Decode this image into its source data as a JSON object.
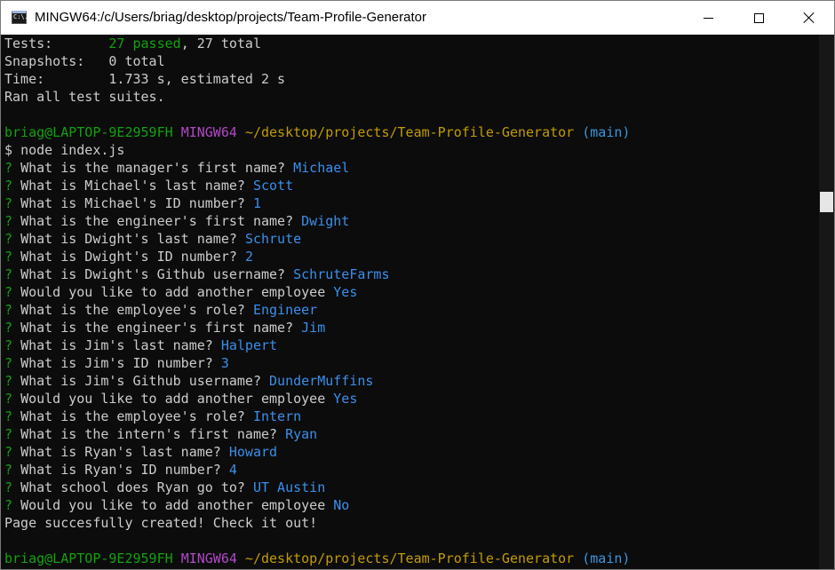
{
  "window": {
    "title": "MINGW64:/c/Users/briag/desktop/projects/Team-Profile-Generator",
    "icon_text": "C:\\."
  },
  "colors": {
    "background": "#0c0c0c",
    "text": "#cccccc",
    "green": "#13a10e",
    "purple": "#b148c6",
    "yellow": "#c19c00",
    "cyan": "#3a96dd",
    "answer_blue": "#3b8eea"
  },
  "terminal": {
    "summary": [
      {
        "label": "Tests:       ",
        "highlight": "27 passed",
        "rest": ", 27 total"
      },
      {
        "label": "Snapshots:   ",
        "highlight": "",
        "rest": "0 total"
      },
      {
        "label": "Time:        ",
        "highlight": "",
        "rest": "1.733 s, estimated 2 s"
      }
    ],
    "ran_all": "Ran all test suites.",
    "prompt": {
      "user_host": "briag@LAPTOP-9E2959FH",
      "shell": "MINGW64",
      "path": "~/desktop/projects/Team-Profile-Generator",
      "branch": "(main)",
      "dollar": "$"
    },
    "command": "node index.js",
    "questions": [
      {
        "q": "What is the manager's first name?",
        "a": "Michael"
      },
      {
        "q": "What is Michael's last name?",
        "a": "Scott"
      },
      {
        "q": "What is Michael's ID number?",
        "a": "1"
      },
      {
        "q": "What is the engineer's first name?",
        "a": "Dwight"
      },
      {
        "q": "What is Dwight's last name?",
        "a": "Schrute"
      },
      {
        "q": "What is Dwight's ID number?",
        "a": "2"
      },
      {
        "q": "What is Dwight's Github username?",
        "a": "SchruteFarms"
      },
      {
        "q": "Would you like to add another employee",
        "a": "Yes"
      },
      {
        "q": "What is the employee's role?",
        "a": "Engineer"
      },
      {
        "q": "What is the engineer's first name?",
        "a": "Jim"
      },
      {
        "q": "What is Jim's last name?",
        "a": "Halpert"
      },
      {
        "q": "What is Jim's ID number?",
        "a": "3"
      },
      {
        "q": "What is Jim's Github username?",
        "a": "DunderMuffins"
      },
      {
        "q": "Would you like to add another employee",
        "a": "Yes"
      },
      {
        "q": "What is the employee's role?",
        "a": "Intern"
      },
      {
        "q": "What is the intern's first name?",
        "a": "Ryan"
      },
      {
        "q": "What is Ryan's last name?",
        "a": "Howard"
      },
      {
        "q": "What is Ryan's ID number?",
        "a": "4"
      },
      {
        "q": "What school does Ryan go to?",
        "a": "UT Austin"
      },
      {
        "q": "Would you like to add another employee",
        "a": "No"
      }
    ],
    "question_mark": "?",
    "result": "Page succesfully created! Check it out!"
  }
}
